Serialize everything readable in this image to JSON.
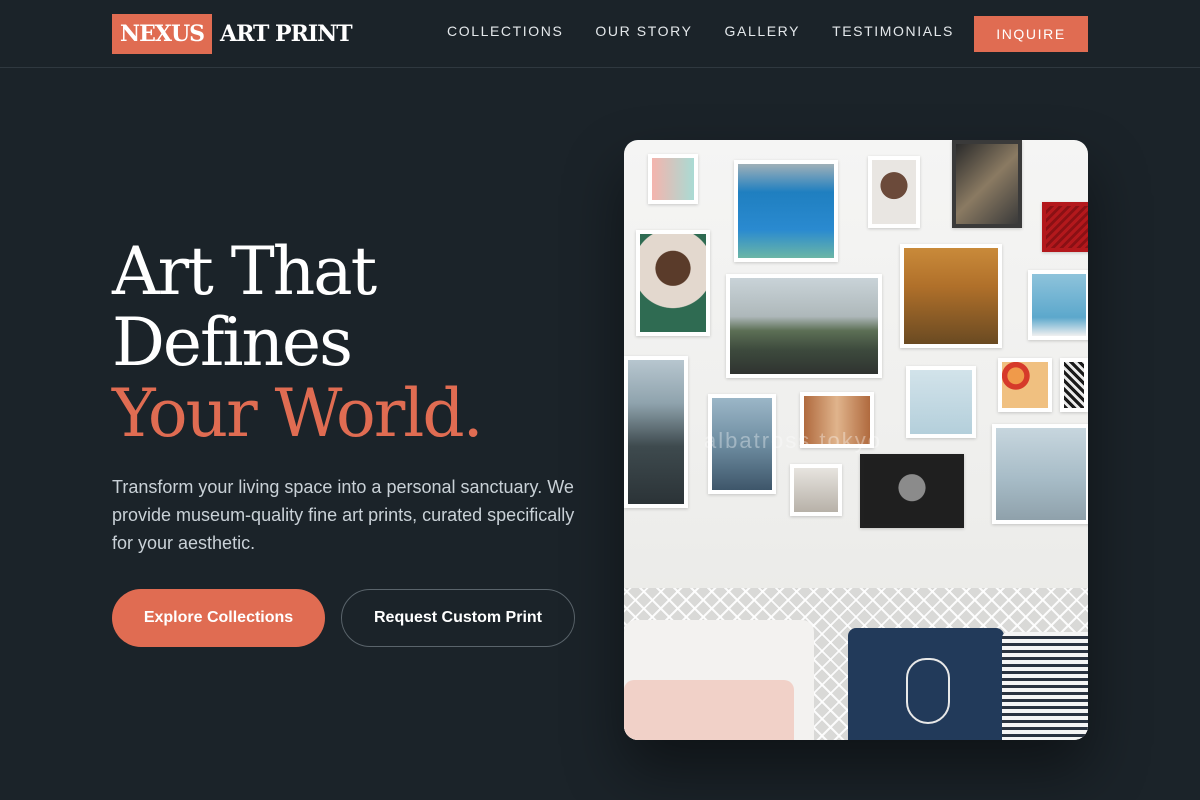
{
  "brand": {
    "logo_box": "NEXUS",
    "logo_rest": "ART PRINT"
  },
  "nav": {
    "links": [
      "COLLECTIONS",
      "OUR STORY",
      "GALLERY",
      "TESTIMONIALS"
    ],
    "cta": "INQUIRE"
  },
  "hero": {
    "title_line1": "Art That",
    "title_line2": "Defines",
    "title_accent": "Your World.",
    "description": "Transform your living space into a personal sanctuary. We provide museum-quality fine art prints, curated specifically for your aesthetic.",
    "primary_button": "Explore Collections",
    "secondary_button": "Request Custom Print",
    "image_watermark": "albatross tokyo"
  },
  "colors": {
    "background": "#1b2329",
    "accent": "#e06c52",
    "text_muted": "#c9d1d7"
  }
}
